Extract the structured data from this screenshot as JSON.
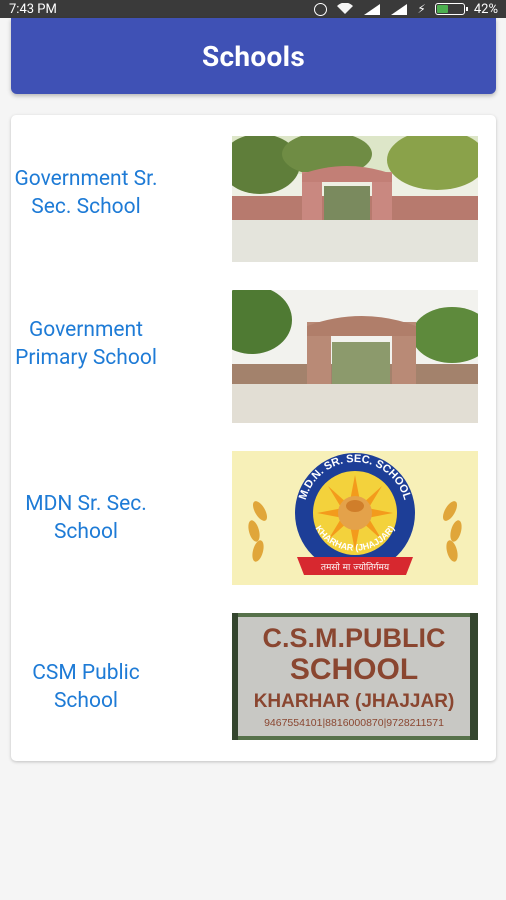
{
  "status_bar": {
    "time": "7:43 PM",
    "battery_percent": "42%",
    "battery_level": 0.42
  },
  "app_bar": {
    "title": "Schools"
  },
  "schools": [
    {
      "name": "Government Sr. Sec. School",
      "image_icon": "school-gate-photo"
    },
    {
      "name": "Government Primary School",
      "image_icon": "school-gate-photo"
    },
    {
      "name": "MDN Sr. Sec. School",
      "image_icon": "school-logo",
      "logo_text": {
        "ring": "M.D.N. SR. SEC. SCHOOL",
        "place": "KHARHAR (JHAJJAR)",
        "motto": "तमसो मा ज्योतिर्गमय"
      }
    },
    {
      "name": "CSM Public School",
      "image_icon": "school-sign-photo",
      "sign_text": {
        "line1": "C.S.M.PUBLIC",
        "line2": "SCHOOL",
        "line3": "KHARHAR (JHAJJAR)",
        "phones": "9467554101|8816000870|9728211571"
      }
    }
  ],
  "colors": {
    "app_bar": "#3f51b5",
    "link_text": "#1e7bd6",
    "status_bar": "#3a3a3a",
    "background": "#f5f5f5"
  }
}
